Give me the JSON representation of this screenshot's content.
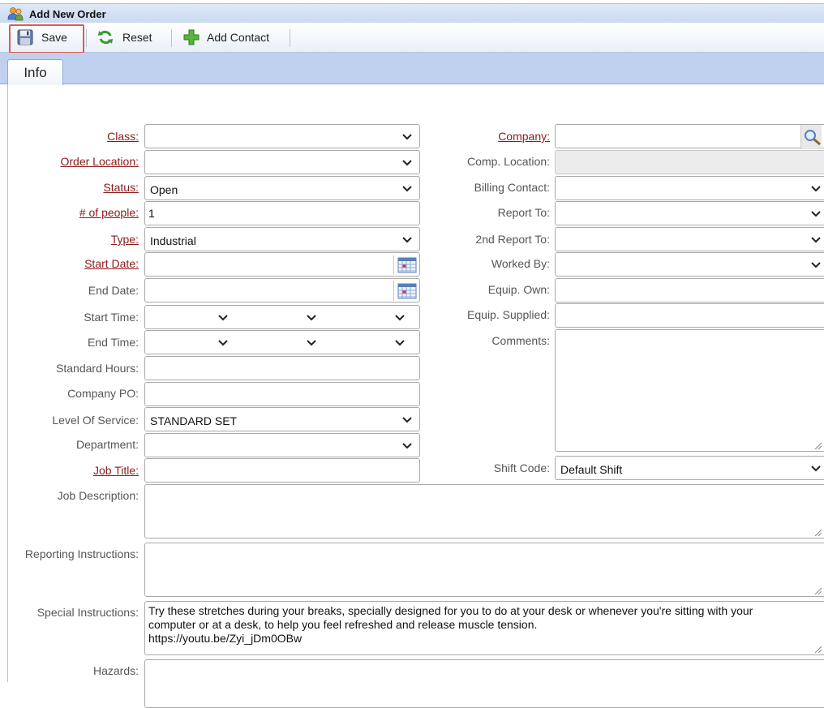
{
  "window": {
    "title": "Add New Order"
  },
  "toolbar": {
    "save_label": "Save",
    "reset_label": "Reset",
    "add_contact_label": "Add Contact"
  },
  "tabs": [
    {
      "label": "Info",
      "active": true
    }
  ],
  "left_fields": {
    "class": {
      "label": "Class:",
      "value": ""
    },
    "order_location": {
      "label": "Order Location:",
      "value": ""
    },
    "status": {
      "label": "Status:",
      "value": "Open"
    },
    "num_people": {
      "label": "# of people:",
      "value": "1"
    },
    "type": {
      "label": "Type:",
      "value": "Industrial"
    },
    "start_date": {
      "label": "Start Date:",
      "value": ""
    },
    "end_date": {
      "label": "End Date:",
      "value": ""
    },
    "start_time": {
      "label": "Start Time:"
    },
    "end_time": {
      "label": "End Time:"
    },
    "standard_hours": {
      "label": "Standard Hours:",
      "value": ""
    },
    "company_po": {
      "label": "Company PO:",
      "value": ""
    },
    "level_of_service": {
      "label": "Level Of Service:",
      "value": "STANDARD SET"
    },
    "department": {
      "label": "Department:",
      "value": ""
    },
    "job_title": {
      "label": "Job Title:",
      "value": ""
    }
  },
  "right_fields": {
    "company": {
      "label": "Company:",
      "value": ""
    },
    "comp_location": {
      "label": "Comp. Location:",
      "value": ""
    },
    "billing_contact": {
      "label": "Billing Contact:",
      "value": ""
    },
    "report_to": {
      "label": "Report To:",
      "value": ""
    },
    "second_report_to": {
      "label": "2nd Report To:",
      "value": ""
    },
    "worked_by": {
      "label": "Worked By:",
      "value": ""
    },
    "equip_own": {
      "label": "Equip. Own:",
      "value": ""
    },
    "equip_supplied": {
      "label": "Equip. Supplied:",
      "value": ""
    },
    "comments": {
      "label": "Comments:",
      "value": ""
    },
    "shift_code": {
      "label": "Shift Code:",
      "value": "Default Shift"
    }
  },
  "wide_fields": {
    "job_description": {
      "label": "Job Description:",
      "value": ""
    },
    "reporting_instructions": {
      "label": "Reporting Instructions:",
      "value": ""
    },
    "special_instructions": {
      "label": "Special Instructions:",
      "lines": [
        "Try these stretches during your breaks, specially designed for you to do at your desk or whenever you're sitting with your",
        "computer or at a desk, to help you feel refreshed and release muscle tension.",
        "https://youtu.be/Zyi_jDm0OBw"
      ]
    },
    "hazards": {
      "label": "Hazards:",
      "value": ""
    }
  },
  "colors": {
    "required_label": "#8b1a1a",
    "label": "#555555",
    "tab_strip": "#bfd1ef",
    "highlight": "#e05a5a"
  }
}
